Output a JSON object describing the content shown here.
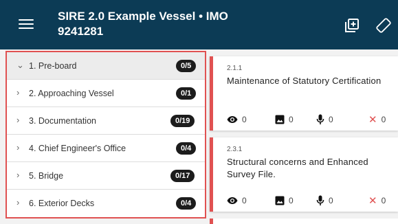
{
  "header": {
    "title_line1": "SIRE 2.0 Example Vessel • IMO",
    "title_line2": "9241281",
    "menu_icon": "hamburger-menu-icon",
    "add_icon": "add-box-icon",
    "rotate_icon": "screen-rotation-icon"
  },
  "sections": [
    {
      "label": "1. Pre-board",
      "count": "0/5",
      "expanded": true
    },
    {
      "label": "2. Approaching Vessel",
      "count": "0/1",
      "expanded": false
    },
    {
      "label": "3. Documentation",
      "count": "0/19",
      "expanded": false
    },
    {
      "label": "4. Chief Engineer's Office",
      "count": "0/4",
      "expanded": false
    },
    {
      "label": "5. Bridge",
      "count": "0/17",
      "expanded": false
    },
    {
      "label": "6. Exterior Decks",
      "count": "0/4",
      "expanded": false
    }
  ],
  "questions": [
    {
      "code": "2.1.1",
      "title": "Maintenance of Statutory Certification",
      "views": "0",
      "photos": "0",
      "audio": "0",
      "issues": "0"
    },
    {
      "code": "2.3.1",
      "title": "Structural concerns and Enhanced Survey File.",
      "views": "0",
      "photos": "0",
      "audio": "0",
      "issues": "0"
    }
  ],
  "colors": {
    "header_bg": "#0c3b55",
    "accent_red": "#e05151",
    "badge_bg": "#1c1c1c"
  }
}
